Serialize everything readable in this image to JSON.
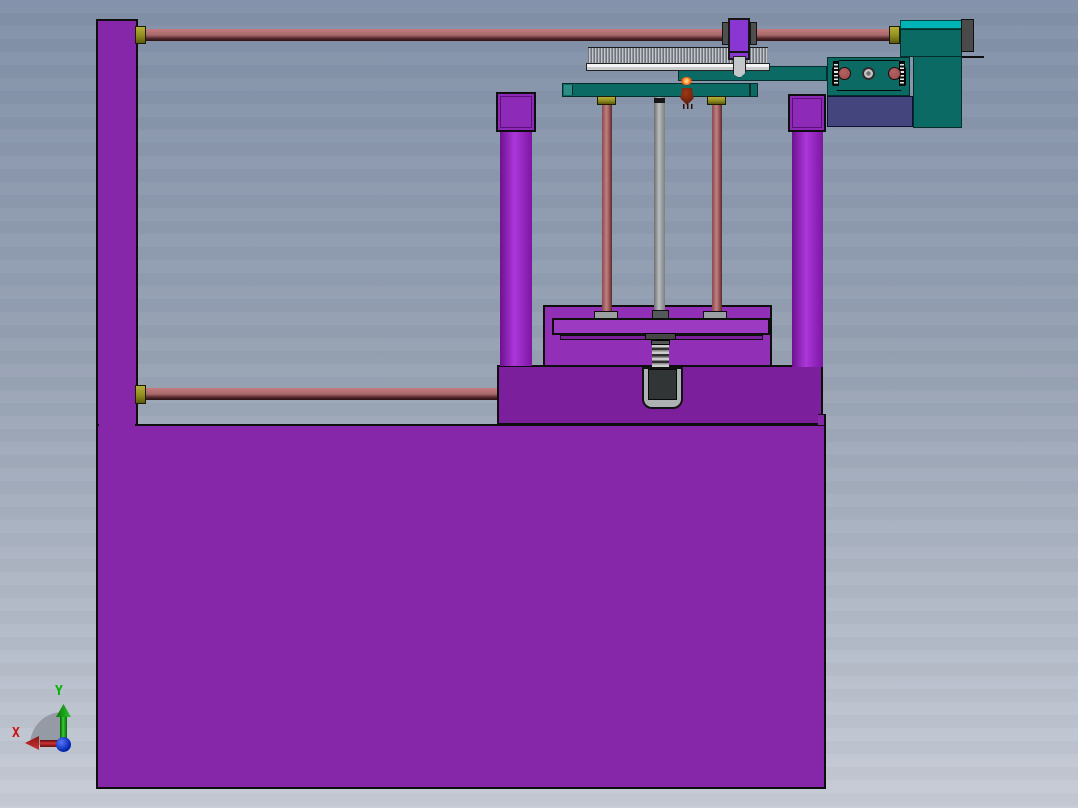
{
  "app": {
    "type": "cad-3d-viewport",
    "view": "front orthographic view of purple press machine assembly"
  },
  "axis_triad": {
    "x_label": "X",
    "y_label": "Y"
  },
  "colors": {
    "bg-top": "#8291a9",
    "bg-mid": "#97a2b4",
    "bg-bottom": "#c7ccd6",
    "outline": "#0e0e0e",
    "purple-frame": "#8627a9",
    "purple-dark": "#7b1f9d",
    "purple-box": "#9130b6",
    "purple-plate": "#9d3ac2",
    "pillar-edge": "#6d1190",
    "pillar-mid": "#ab37da",
    "pillar-edge2": "#7d16a3",
    "slider-purple": "#8a36d3",
    "olive-collar": "#8f8c1f",
    "teal": "#0b6a63",
    "teal-light": "#2e8d84",
    "cyan": "#00b3b6",
    "indigo": "#45457e",
    "dark-gray": "#4a4a4a",
    "metal": "#c4c7c9",
    "rack-body": "#d2d4d6",
    "bearing-red": "#9c4a4a",
    "rod-red": "#a86a6c",
    "cone-dark": "#5a1a08",
    "cone-glow": "#ff5a00",
    "axis-x": "#cc1111",
    "axis-y": "#00b400",
    "axis-z": "#2244cc"
  },
  "parts": [
    {
      "name": "base-block",
      "color": "purple-frame"
    },
    {
      "name": "frame-column",
      "color": "purple-frame"
    },
    {
      "name": "pedestal",
      "color": "purple-dark"
    },
    {
      "name": "top-guide-rod",
      "color": "rod-red"
    },
    {
      "name": "middle-guide-rod",
      "color": "rod-red"
    },
    {
      "name": "rod-collars",
      "color": "olive-collar"
    },
    {
      "name": "left-pillar",
      "color": "pillar-mid"
    },
    {
      "name": "right-pillar",
      "color": "pillar-mid"
    },
    {
      "name": "gear-rack",
      "color": "rack-body"
    },
    {
      "name": "rack-slider-carriage",
      "color": "slider-purple"
    },
    {
      "name": "slider-pawl",
      "color": "metal"
    },
    {
      "name": "rack-support-bar",
      "color": "teal"
    },
    {
      "name": "tool-plate",
      "color": "teal"
    },
    {
      "name": "tool-cone",
      "color": "cone-dark"
    },
    {
      "name": "lift-rods",
      "color": "rod-red"
    },
    {
      "name": "press-box",
      "color": "purple-box"
    },
    {
      "name": "press-plate",
      "color": "purple-plate"
    },
    {
      "name": "lead-screw-spring",
      "color": "metal"
    },
    {
      "name": "die-block",
      "color": "metal"
    },
    {
      "name": "bearing-housing",
      "color": "teal"
    },
    {
      "name": "motor-housing",
      "color": "teal"
    },
    {
      "name": "motor-end-cap",
      "color": "dark-gray"
    },
    {
      "name": "indigo-mount",
      "color": "indigo"
    }
  ]
}
